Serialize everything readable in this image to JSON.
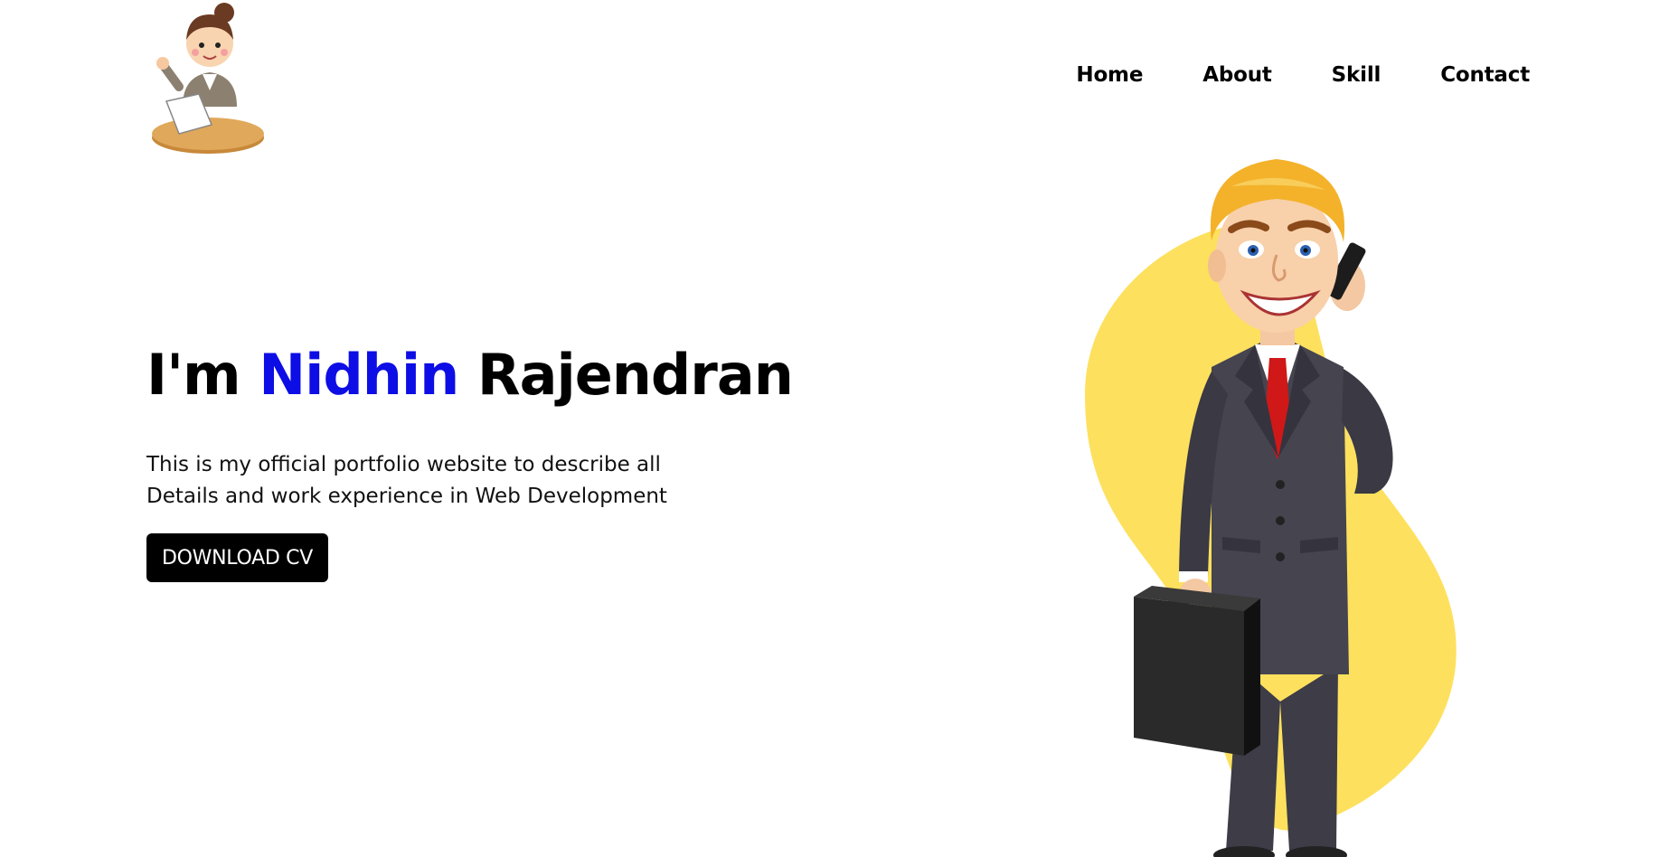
{
  "brand": {
    "logo_icon": "woman-at-desk-icon"
  },
  "nav": {
    "items": [
      {
        "label": "Home"
      },
      {
        "label": "About"
      },
      {
        "label": "Skill"
      },
      {
        "label": "Contact"
      }
    ]
  },
  "hero": {
    "title_prefix": "I'm ",
    "title_highlight": "Nidhin",
    "title_suffix": " Rajendran",
    "description_line1": "This is my official portfolio website to describe all",
    "description_line2": "Details and work experience in Web Development",
    "cta_label": "DOWNLOAD CV",
    "illustration_icon": "businessman-on-phone-illustration"
  },
  "colors": {
    "accent": "#0d0de5",
    "button_bg": "#000000",
    "blob": "#fde05d"
  }
}
